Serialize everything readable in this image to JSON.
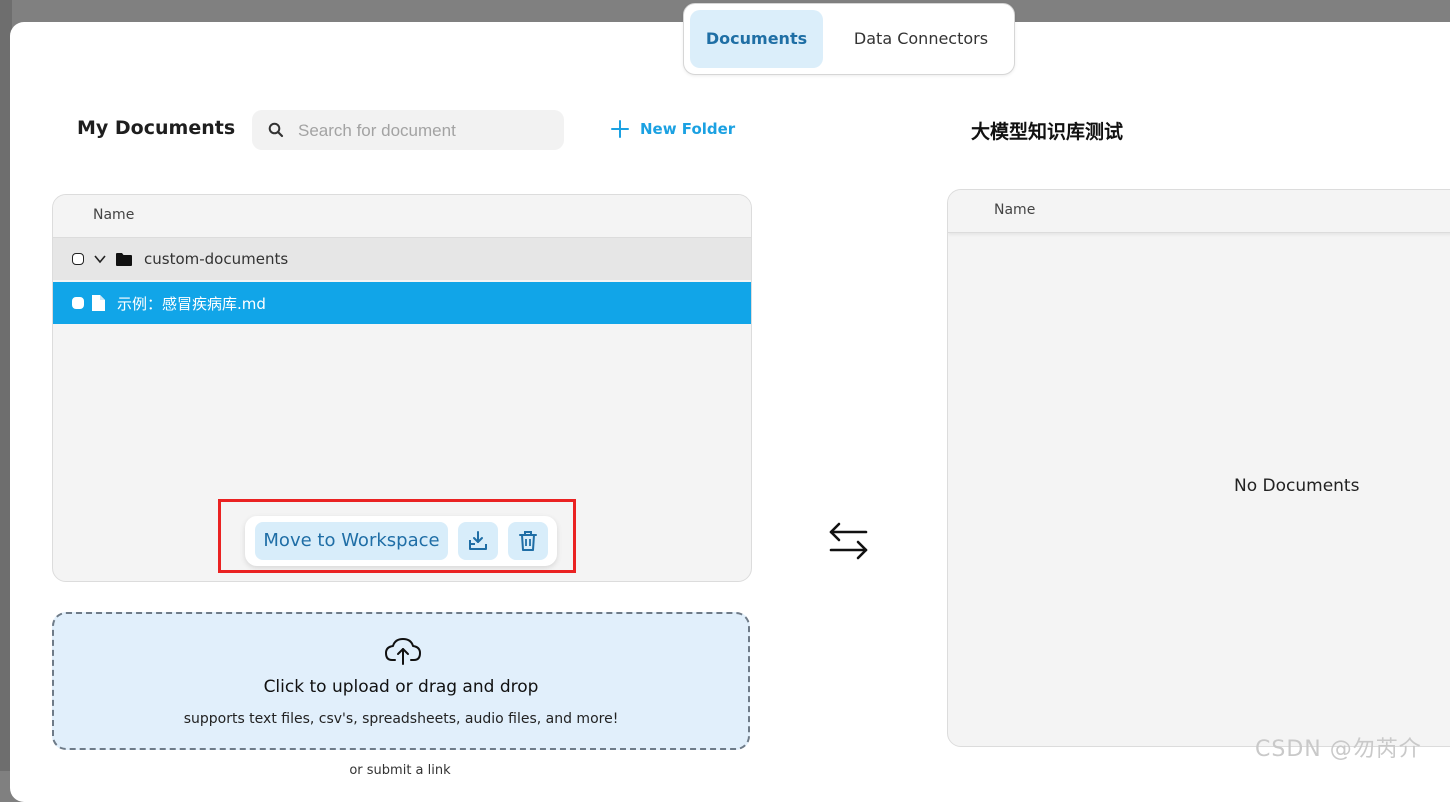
{
  "tabs": [
    {
      "label": "Documents",
      "active": true
    },
    {
      "label": "Data Connectors",
      "active": false
    }
  ],
  "my_documents": {
    "title": "My Documents",
    "search_placeholder": "Search for document",
    "new_folder_label": "New Folder",
    "column_name": "Name",
    "folder": {
      "name": "custom-documents",
      "icon": "folder-icon",
      "expanded": true
    },
    "file": {
      "name": "示例：感冒疾病库.md",
      "icon": "file-icon",
      "selected": true
    }
  },
  "actions": {
    "move_label": "Move to Workspace",
    "download_icon": "download-icon",
    "delete_icon": "trash-icon"
  },
  "upload": {
    "title": "Click to upload or drag and drop",
    "subtitle": "supports text files, csv's, spreadsheets, audio files, and more!",
    "submit_link": "or submit a link",
    "icon": "cloud-upload-icon"
  },
  "workspace": {
    "title": "大模型知识库测试",
    "column_name": "Name",
    "empty_text": "No Documents"
  },
  "watermark": "CSDN @勿芮介",
  "colors": {
    "accent": "#1ba1e2",
    "selected_row": "#11a5e8",
    "tab_active_bg": "#dbeefa",
    "highlight_box": "#ea2222"
  }
}
